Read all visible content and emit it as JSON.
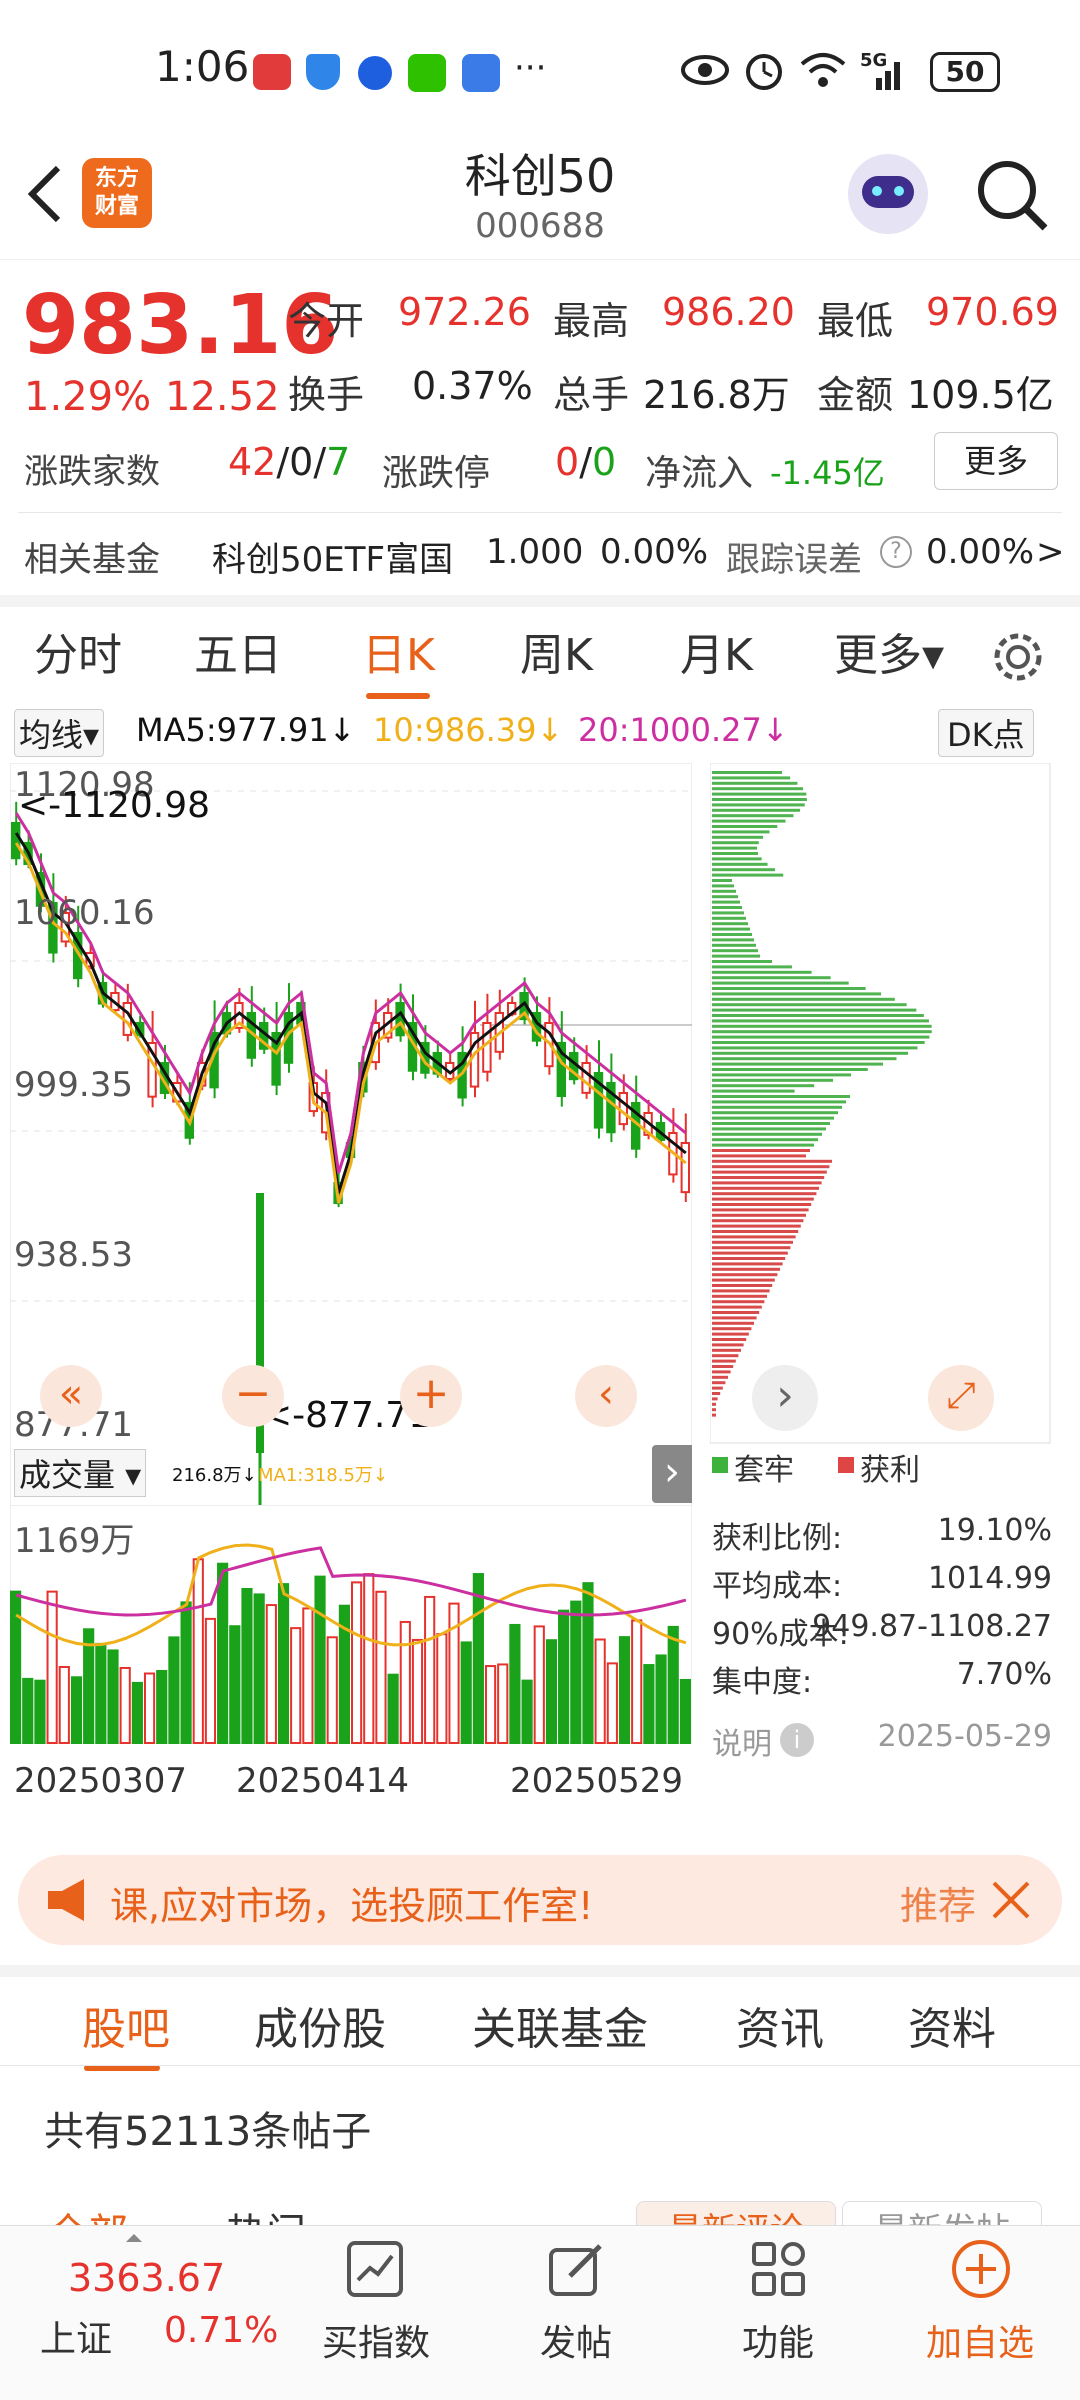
{
  "status": {
    "time": "1:06",
    "battery": "50",
    "net": "5G",
    "more": "···"
  },
  "header": {
    "title": "科创50",
    "code": "000688",
    "logo_line1": "东方",
    "logo_line2": "财富"
  },
  "quote": {
    "price": "983.16",
    "pct": "1.29%",
    "change": "12.52",
    "open_label": "今开",
    "open": "972.26",
    "high_label": "最高",
    "high": "986.20",
    "low_label": "最低",
    "low": "970.69",
    "turnover_label": "换手",
    "turnover": "0.37%",
    "vol_label": "总手",
    "vol": "216.8万",
    "amt_label": "金额",
    "amt": "109.5亿",
    "breadth_label": "涨跌家数",
    "breadth_up": "42",
    "breadth_sep1": "/",
    "breadth_flat": "0",
    "breadth_sep2": "/",
    "breadth_down": "7",
    "limit_label": "涨跌停",
    "limit_up": "0",
    "limit_sep": "/",
    "limit_down": "0",
    "inflow_label": "净流入",
    "inflow": "-1.45亿",
    "more_btn": "更多",
    "fund_label": "相关基金",
    "fund_name": "科创50ETF富国",
    "fund_price": "1.000",
    "fund_pct": "0.00%",
    "track_label": "跟踪误差",
    "track_val": "0.00%",
    "arrow": ">"
  },
  "tabs": [
    "分时",
    "五日",
    "日K",
    "周K",
    "月K",
    "更多▾"
  ],
  "indicators": {
    "ma_btn": "均线▾",
    "ma5": "MA5:977.91↓",
    "ma10": "10:986.39↓",
    "ma20": "20:1000.27↓",
    "dk_btn": "DK点"
  },
  "y_labels": [
    "1120.98",
    "1060.16",
    "999.35",
    "938.53",
    "877.71"
  ],
  "max_marker": "<-1120.98",
  "min_marker": "<-877.71",
  "volume": {
    "selector": "成交量 ▾",
    "text1": "216.8万↓",
    "text2": "MA1:318.5万↓",
    "max_label": "1169万"
  },
  "dates": [
    "20250307",
    "20250414",
    "20250529"
  ],
  "cost": {
    "legend_trapped": "套牢",
    "legend_profit": "获利",
    "rows": [
      {
        "k": "获利比例:",
        "v": "19.10%"
      },
      {
        "k": "平均成本:",
        "v": "1014.99"
      },
      {
        "k": "90%成本:",
        "v": "949.87-1108.27"
      },
      {
        "k": "集中度:",
        "v": "7.70%"
      }
    ],
    "note": "说明",
    "date": "2025-05-29"
  },
  "banner": {
    "text": "课,应对市场，选投顾工作室!",
    "action": "推荐"
  },
  "subtabs": [
    "股吧",
    "成份股",
    "关联基金",
    "资讯",
    "资料"
  ],
  "posts": {
    "count": "共有52113条帖子",
    "tab1": "全部",
    "tab2": "热门",
    "sort1": "最新评论",
    "sort2": "最新发帖"
  },
  "bottom": {
    "index_value": "3363.67",
    "index_name": "上证",
    "index_pct": "0.71%",
    "btn1": "买指数",
    "btn2": "发帖",
    "btn3": "功能",
    "btn4": "加自选"
  },
  "colors": {
    "up": "#e5322d",
    "down": "#1aa31a",
    "accent": "#e8611a",
    "ma5": "#111111",
    "ma10": "#f0b01a",
    "ma20": "#cc2fa0"
  }
}
